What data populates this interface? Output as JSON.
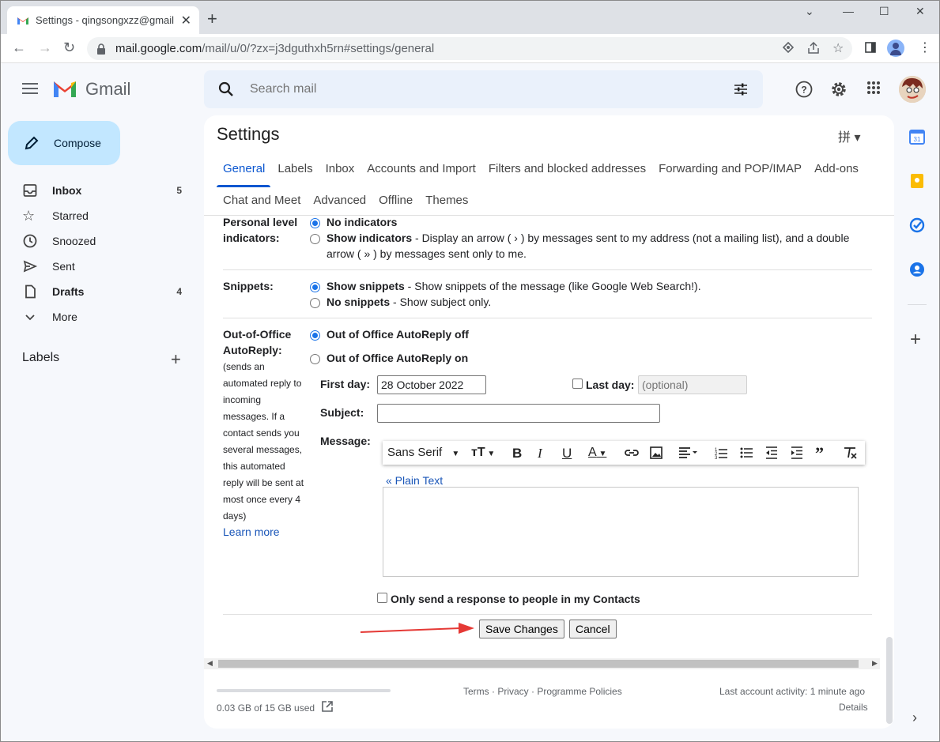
{
  "browser": {
    "tab_title": "Settings - qingsongxzz@gmail",
    "url_host": "mail.google.com",
    "url_path": "/mail/u/0/?zx=j3dguthxh5rn#settings/general"
  },
  "header": {
    "app_name": "Gmail",
    "search_placeholder": "Search mail"
  },
  "sidebar": {
    "compose_label": "Compose",
    "items": [
      {
        "label": "Inbox",
        "count": "5"
      },
      {
        "label": "Starred",
        "count": ""
      },
      {
        "label": "Snoozed",
        "count": ""
      },
      {
        "label": "Sent",
        "count": ""
      },
      {
        "label": "Drafts",
        "count": "4"
      },
      {
        "label": "More",
        "count": ""
      }
    ],
    "labels_heading": "Labels"
  },
  "settings": {
    "title": "Settings",
    "tabs_row1": [
      "General",
      "Labels",
      "Inbox",
      "Accounts and Import",
      "Filters and blocked addresses",
      "Forwarding and POP/IMAP",
      "Add-ons"
    ],
    "tabs_row2": [
      "Chat and Meet",
      "Advanced",
      "Offline",
      "Themes"
    ],
    "indicators": {
      "label_line1": "Personal level",
      "label_line2": "indicators:",
      "option1": "No indicators",
      "option2_bold": "Show indicators",
      "option2_desc_line1": " - Display an arrow ( › ) by messages sent to my address (not a mailing list), and a double",
      "option2_desc_line2": "arrow ( » ) by messages sent only to me."
    },
    "snippets": {
      "label": "Snippets:",
      "option1_bold": "Show snippets",
      "option1_desc": " - Show snippets of the message (like Google Web Search!).",
      "option2_bold": "No snippets",
      "option2_desc": " - Show subject only."
    },
    "ooo": {
      "label_line1": "Out-of-Office",
      "label_line2": "AutoReply:",
      "note": [
        "(sends an",
        "automated reply to",
        "incoming",
        "messages. If a",
        "contact sends you",
        "several messages,",
        "this automated",
        "reply will be sent at",
        "most once every 4",
        "days)"
      ],
      "learn_more": "Learn more",
      "option_off": "Out of Office AutoReply off",
      "option_on": "Out of Office AutoReply on",
      "first_day_label": "First day:",
      "first_day_value": "28 October 2022",
      "last_day_label": "Last day:",
      "last_day_placeholder": "(optional)",
      "subject_label": "Subject:",
      "subject_value": "",
      "message_label": "Message:",
      "font_name": "Sans Serif",
      "plain_text_link": "« Plain Text",
      "contacts_only": "Only send a response to people in my Contacts"
    },
    "save_button": "Save Changes",
    "cancel_button": "Cancel"
  },
  "footer": {
    "storage_text": "0.03 GB of 15 GB used",
    "links": "Terms · Privacy · Programme Policies",
    "activity": "Last account activity: 1 minute ago",
    "details": "Details"
  },
  "colors": {
    "accent": "#0b57d0",
    "compose_bg": "#c2e7ff",
    "search_bg": "#eaf1fb",
    "annotation_arrow": "#e53935"
  }
}
